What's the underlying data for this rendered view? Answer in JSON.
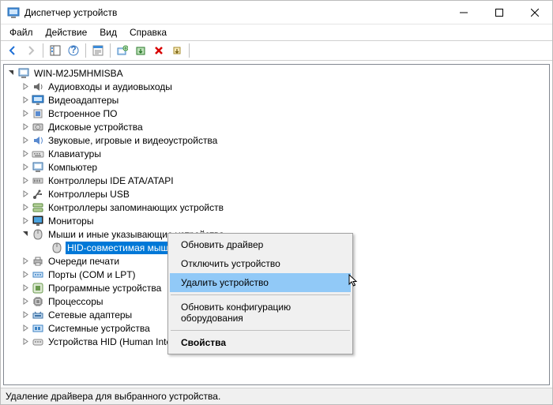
{
  "window": {
    "title": "Диспетчер устройств"
  },
  "menu": {
    "file": "Файл",
    "action": "Действие",
    "view": "Вид",
    "help": "Справка"
  },
  "tree": {
    "root": "WIN-M2J5MHMISBA",
    "categories": [
      {
        "label": "Аудиовходы и аудиовыходы",
        "icon": "audio"
      },
      {
        "label": "Видеоадаптеры",
        "icon": "display"
      },
      {
        "label": "Встроенное ПО",
        "icon": "firmware"
      },
      {
        "label": "Дисковые устройства",
        "icon": "disk"
      },
      {
        "label": "Звуковые, игровые и видеоустройства",
        "icon": "sound"
      },
      {
        "label": "Клавиатуры",
        "icon": "keyboard"
      },
      {
        "label": "Компьютер",
        "icon": "computer"
      },
      {
        "label": "Контроллеры IDE ATA/ATAPI",
        "icon": "ide"
      },
      {
        "label": "Контроллеры USB",
        "icon": "usb"
      },
      {
        "label": "Контроллеры запоминающих устройств",
        "icon": "storage"
      },
      {
        "label": "Мониторы",
        "icon": "monitor"
      },
      {
        "label": "Мыши и иные указывающие устройства",
        "icon": "mouse",
        "expanded": true,
        "children": [
          {
            "label": "HID-совместимая мышь",
            "icon": "mouse",
            "selected": true
          }
        ]
      },
      {
        "label": "Очереди печати",
        "icon": "printer"
      },
      {
        "label": "Порты (COM и LPT)",
        "icon": "port"
      },
      {
        "label": "Программные устройства",
        "icon": "software"
      },
      {
        "label": "Процессоры",
        "icon": "cpu"
      },
      {
        "label": "Сетевые адаптеры",
        "icon": "network"
      },
      {
        "label": "Системные устройства",
        "icon": "system"
      },
      {
        "label": "Устройства HID (Human Interface Devices)",
        "icon": "hid"
      }
    ]
  },
  "context_menu": {
    "items": [
      {
        "label": "Обновить драйвер"
      },
      {
        "label": "Отключить устройство"
      },
      {
        "label": "Удалить устройство",
        "hover": true
      },
      {
        "sep": true
      },
      {
        "label": "Обновить конфигурацию оборудования"
      },
      {
        "sep": true
      },
      {
        "label": "Свойства",
        "bold": true
      }
    ]
  },
  "status": {
    "text": "Удаление драйвера для выбранного устройства."
  }
}
